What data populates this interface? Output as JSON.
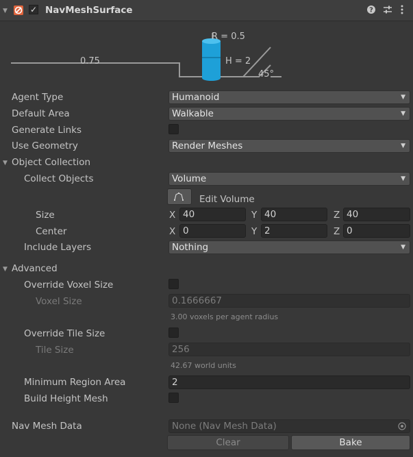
{
  "header": {
    "title": "NavMeshSurface"
  },
  "diagram": {
    "radius": "R = 0.5",
    "height": "H = 2",
    "step": "0.75",
    "slope": "45°"
  },
  "fields": {
    "agent_type": {
      "label": "Agent Type",
      "value": "Humanoid"
    },
    "default_area": {
      "label": "Default Area",
      "value": "Walkable"
    },
    "generate_links": {
      "label": "Generate Links"
    },
    "use_geometry": {
      "label": "Use Geometry",
      "value": "Render Meshes"
    },
    "object_collection": {
      "label": "Object Collection"
    },
    "collect_objects": {
      "label": "Collect Objects",
      "value": "Volume"
    },
    "edit_volume": {
      "label": "Edit Volume"
    },
    "size": {
      "label": "Size",
      "x": "40",
      "y": "40",
      "z": "40"
    },
    "center": {
      "label": "Center",
      "x": "0",
      "y": "2",
      "z": "0"
    },
    "include_layers": {
      "label": "Include Layers",
      "value": "Nothing"
    },
    "advanced": {
      "label": "Advanced"
    },
    "override_voxel": {
      "label": "Override Voxel Size"
    },
    "voxel_size": {
      "label": "Voxel Size",
      "value": "0.1666667",
      "help": "3.00 voxels per agent radius"
    },
    "override_tile": {
      "label": "Override Tile Size"
    },
    "tile_size": {
      "label": "Tile Size",
      "value": "256",
      "help": "42.67 world units"
    },
    "min_region": {
      "label": "Minimum Region Area",
      "value": "2"
    },
    "build_height": {
      "label": "Build Height Mesh"
    },
    "nav_mesh_data": {
      "label": "Nav Mesh Data",
      "value": "None (Nav Mesh Data)"
    }
  },
  "axes": {
    "x": "X",
    "y": "Y",
    "z": "Z"
  },
  "buttons": {
    "clear": "Clear",
    "bake": "Bake"
  },
  "colors": {
    "accent": "#1ea0d8",
    "background": "#383838"
  },
  "icons": [
    "foldout-arrow-icon",
    "navmesh-component-icon",
    "checkmark-icon",
    "help-icon",
    "presets-icon",
    "menu-kebab-icon",
    "edit-volume-icon",
    "object-picker-icon"
  ]
}
